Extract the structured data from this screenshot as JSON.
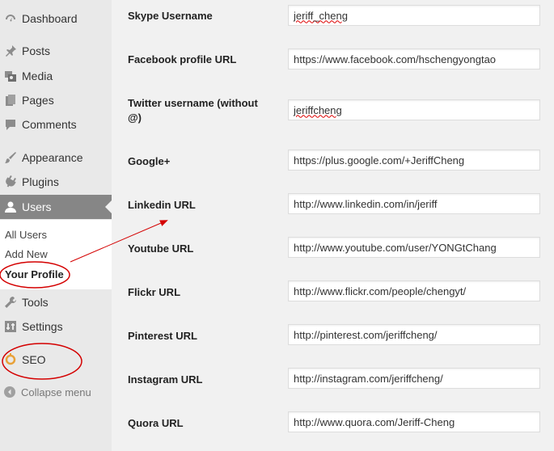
{
  "sidebar": {
    "items": [
      {
        "key": "dashboard",
        "label": "Dashboard",
        "icon": "dashboard-icon"
      },
      {
        "key": "posts",
        "label": "Posts",
        "icon": "pin-icon"
      },
      {
        "key": "media",
        "label": "Media",
        "icon": "media-icon"
      },
      {
        "key": "pages",
        "label": "Pages",
        "icon": "pages-icon"
      },
      {
        "key": "comments",
        "label": "Comments",
        "icon": "comment-icon"
      },
      {
        "key": "appearance",
        "label": "Appearance",
        "icon": "brush-icon"
      },
      {
        "key": "plugins",
        "label": "Plugins",
        "icon": "plug-icon"
      },
      {
        "key": "users",
        "label": "Users",
        "icon": "user-icon"
      },
      {
        "key": "tools",
        "label": "Tools",
        "icon": "wrench-icon"
      },
      {
        "key": "settings",
        "label": "Settings",
        "icon": "settings-icon"
      },
      {
        "key": "seo",
        "label": "SEO",
        "icon": "seo-icon"
      }
    ],
    "submenu": [
      "All Users",
      "Add New",
      "Your Profile"
    ],
    "collapse_label": "Collapse menu"
  },
  "fields": [
    {
      "label": "Skype Username",
      "value": "jeriff_cheng"
    },
    {
      "label": "Facebook profile URL",
      "value": "https://www.facebook.com/hschengyongtao"
    },
    {
      "label": "Twitter username (without @)",
      "value": "jeriffcheng"
    },
    {
      "label": "Google+",
      "value": "https://plus.google.com/+JeriffCheng"
    },
    {
      "label": "Linkedin URL",
      "value": "http://www.linkedin.com/in/jeriff"
    },
    {
      "label": "Youtube URL",
      "value": "http://www.youtube.com/user/YONGtChang"
    },
    {
      "label": "Flickr URL",
      "value": "http://www.flickr.com/people/chengyt/"
    },
    {
      "label": "Pinterest URL",
      "value": "http://pinterest.com/jeriffcheng/"
    },
    {
      "label": "Instagram URL",
      "value": "http://instagram.com/jeriffcheng/"
    },
    {
      "label": "Quora URL",
      "value": "http://www.quora.com/Jeriff-Cheng"
    }
  ],
  "colors": {
    "sidebar_bg": "#e9e9e9",
    "active_bg": "#868686",
    "annotation": "#d40000"
  }
}
